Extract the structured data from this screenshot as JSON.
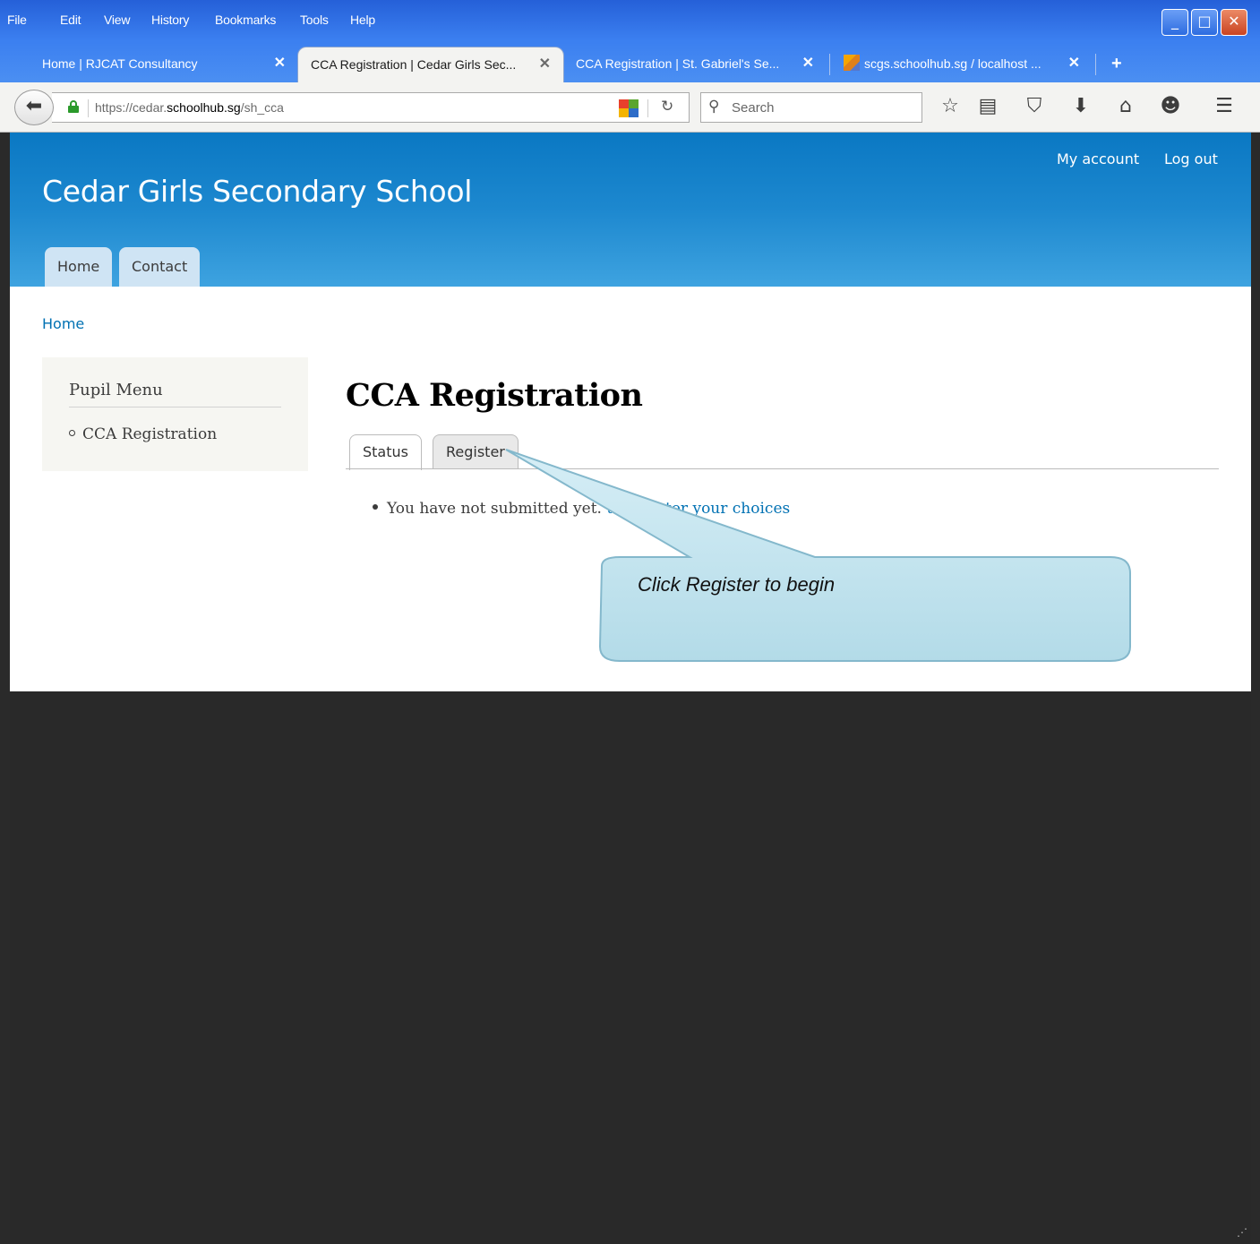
{
  "menubar": {
    "items": [
      "File",
      "Edit",
      "View",
      "History",
      "Bookmarks",
      "Tools",
      "Help"
    ]
  },
  "tabs": [
    {
      "title": "Home | RJCAT Consultancy",
      "active": false
    },
    {
      "title": "CCA Registration | Cedar Girls Sec...",
      "active": true
    },
    {
      "title": "CCA Registration | St. Gabriel's Se...",
      "active": false
    },
    {
      "title": "scgs.schoolhub.sg / localhost ...",
      "active": false,
      "icon": "phpmyadmin-icon"
    }
  ],
  "new_tab_label": "+",
  "navbar": {
    "url_prefix": "https://cedar.",
    "url_host": "schoolhub.sg",
    "url_path": "/sh_cca",
    "search_placeholder": "Search"
  },
  "site": {
    "name": "Cedar Girls Secondary School",
    "secondary_menu": [
      "My account",
      "Log out"
    ],
    "primary_menu": [
      "Home",
      "Contact"
    ]
  },
  "breadcrumb": {
    "home": "Home"
  },
  "sidebar": {
    "title": "Pupil Menu",
    "items": [
      "CCA Registration"
    ]
  },
  "main": {
    "title": "CCA Registration",
    "local_tabs": [
      {
        "label": "Status",
        "active": true
      },
      {
        "label": "Register",
        "active": false
      }
    ],
    "status_text": "You have not submitted yet.",
    "status_link": "to register your choices"
  },
  "callout": {
    "text": "Click Register to begin"
  },
  "colors": {
    "header_top": "#0a78c3",
    "header_bottom": "#3ea3e0",
    "link": "#0071b3",
    "callout_fill": "#bfe2ee",
    "callout_border": "#7fb7cc",
    "footer": "#292929"
  }
}
